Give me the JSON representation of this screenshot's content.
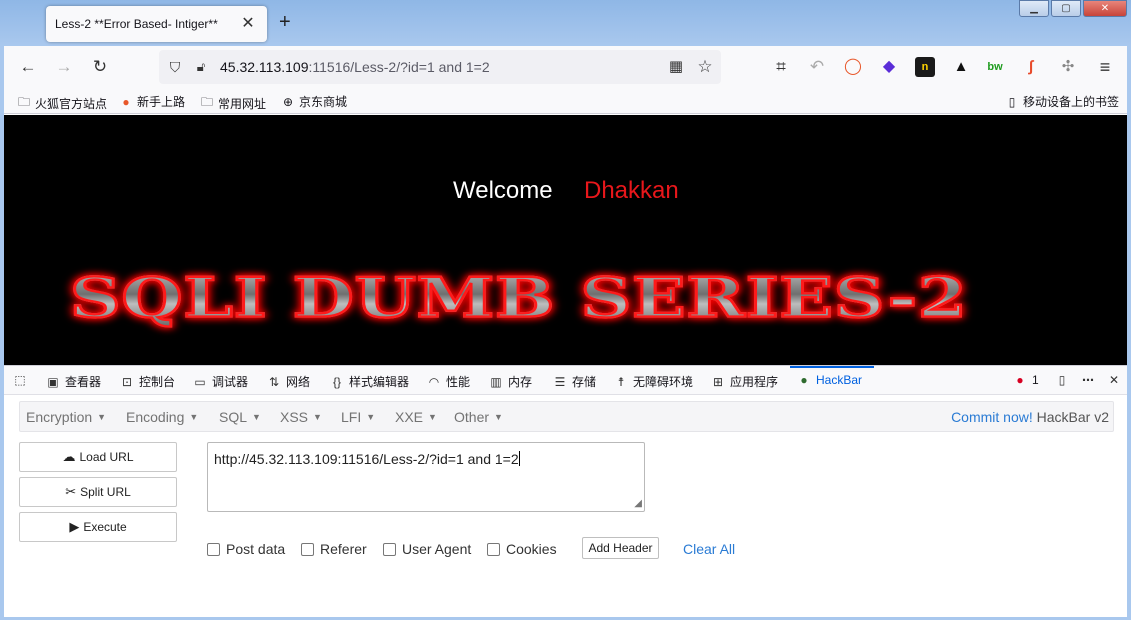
{
  "browser": {
    "tab_title": "Less-2 **Error Based- Intiger**",
    "tab_close": "✕",
    "new_tab": "+",
    "url_host": "45.32.113.109",
    "url_rest": ":11516/Less-2/?id=1 and 1=2"
  },
  "bookmarks": [
    {
      "label": "火狐官方站点",
      "icon": "folder-icon"
    },
    {
      "label": "新手上路",
      "icon": "firefox-icon"
    },
    {
      "label": "常用网址",
      "icon": "folder-icon"
    },
    {
      "label": "京东商城",
      "icon": "globe-icon"
    },
    {
      "label": "移动设备上的书签",
      "icon": "mobile-icon"
    }
  ],
  "page": {
    "welcome": "Welcome",
    "name": "Dhakkan",
    "banner": "SQLI DUMB SERIES-2"
  },
  "devtools": {
    "tabs": [
      "查看器",
      "控制台",
      "调试器",
      "网络",
      "样式编辑器",
      "性能",
      "内存",
      "存储",
      "无障碍环境",
      "应用程序",
      "HackBar"
    ],
    "active_tab": "HackBar",
    "error_count": "1"
  },
  "hackbar": {
    "menus": [
      "Encryption",
      "Encoding",
      "SQL",
      "XSS",
      "LFI",
      "XXE",
      "Other"
    ],
    "commit_link": "Commit now!",
    "version": "HackBar v2",
    "buttons": {
      "load": "Load URL",
      "split": "Split URL",
      "execute": "Execute"
    },
    "url_value": "http://45.32.113.109:11516/Less-2/?id=1 and 1=2",
    "options": [
      "Post data",
      "Referer",
      "User Agent",
      "Cookies"
    ],
    "add_header": "Add Header",
    "clear_all": "Clear All"
  }
}
